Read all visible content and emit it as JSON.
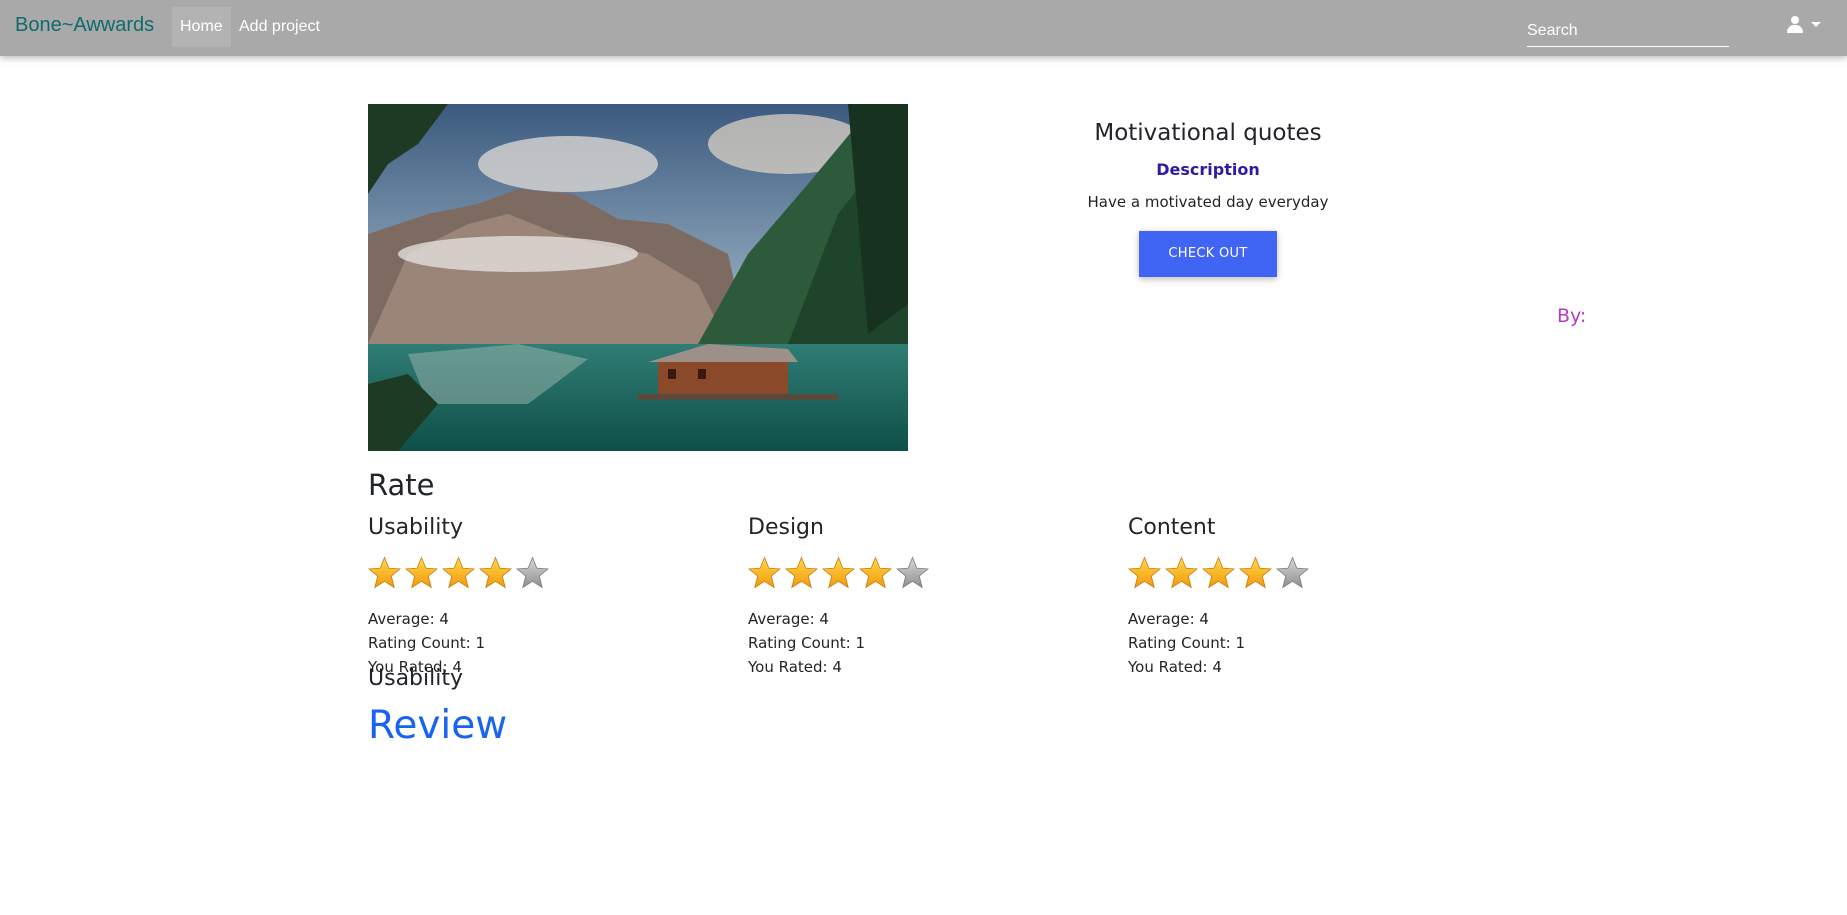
{
  "navbar": {
    "brand": "Bone~Awwards",
    "links": [
      {
        "label": "Home"
      },
      {
        "label": "Add project"
      }
    ],
    "search_placeholder": "Search"
  },
  "project": {
    "title": "Motivational quotes",
    "description_label": "Description",
    "description": "Have a motivated day everyday",
    "button_label": "CHECK OUT",
    "by_label": "By:"
  },
  "rating": {
    "heading": "Rate",
    "categories": [
      {
        "name": "Usability",
        "stars": 4,
        "max": 5,
        "average": "Average: 4",
        "count": "Rating Count: 1",
        "you_rated": "You Rated: 4"
      },
      {
        "name": "Design",
        "stars": 4,
        "max": 5,
        "average": "Average: 4",
        "count": "Rating Count: 1",
        "you_rated": "You Rated: 4"
      },
      {
        "name": "Content",
        "stars": 4,
        "max": 5,
        "average": "Average: 4",
        "count": "Rating Count: 1",
        "you_rated": "You Rated: 4"
      }
    ]
  },
  "footer": {
    "section_label": "Usability",
    "review_link": "Review"
  }
}
